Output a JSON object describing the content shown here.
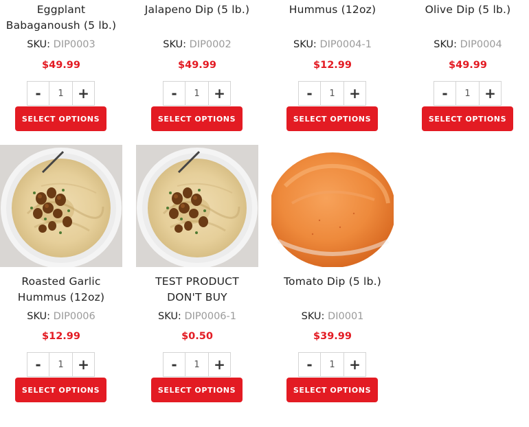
{
  "labels": {
    "sku": "SKU:",
    "minus": "-",
    "plus": "+",
    "select_options": "SELECT OPTIONS"
  },
  "colors": {
    "accent": "#e31b23",
    "sku_value": "#9a9a9a"
  },
  "products": [
    {
      "name_lines": [
        "Eggplant",
        "Babaganoush (5 lb.)"
      ],
      "sku": "DIP0003",
      "price": "$49.99",
      "qty": "1"
    },
    {
      "name_lines": [
        "Jalapeno Dip (5 lb.)"
      ],
      "sku": "DIP0002",
      "price": "$49.99",
      "qty": "1"
    },
    {
      "name_lines": [
        "Hummus (12oz)"
      ],
      "sku": "DIP0004-1",
      "price": "$12.99",
      "qty": "1"
    },
    {
      "name_lines": [
        "Olive Dip (5 lb.)"
      ],
      "sku": "DIP0004",
      "price": "$49.99",
      "qty": "1"
    },
    {
      "name_lines": [
        "Roasted Garlic",
        "Hummus (12oz)"
      ],
      "sku": "DIP0006",
      "price": "$12.99",
      "qty": "1",
      "image": "hummus-bowl-image"
    },
    {
      "name_lines": [
        "TEST PRODUCT",
        "DON'T BUY"
      ],
      "sku": "DIP0006-1",
      "price": "$0.50",
      "qty": "1",
      "image": "hummus-bowl-image"
    },
    {
      "name_lines": [
        "Tomato Dip (5 lb.)"
      ],
      "sku": "DI0001",
      "price": "$39.99",
      "qty": "1",
      "image": "tomato-dip-bowl-image"
    }
  ]
}
